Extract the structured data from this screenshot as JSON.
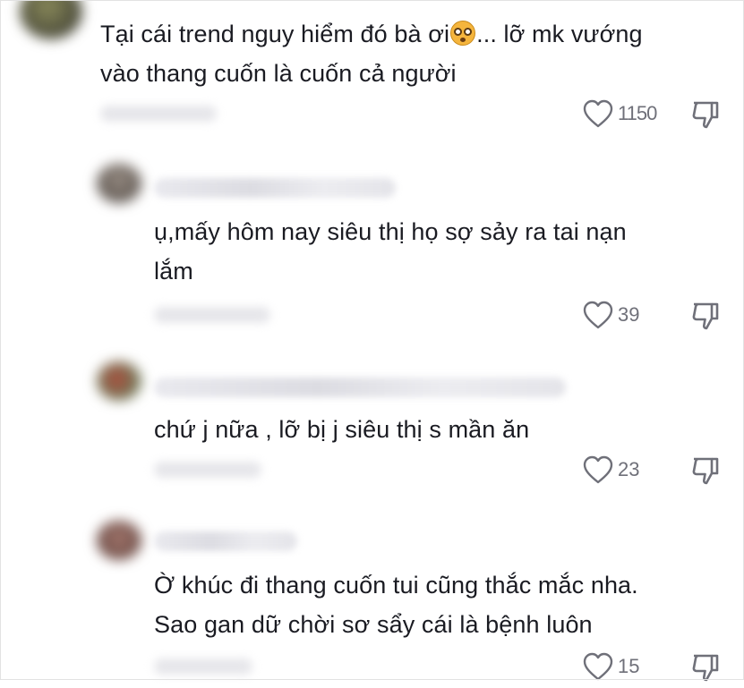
{
  "comments": [
    {
      "text_before_emoji": "Tại cái trend nguy hiểm đó bà ơi",
      "text_after_emoji": "... lỡ mk vướng",
      "text_line2": "vào thang cuốn là cuốn cả người",
      "emoji": "flushed-face",
      "likes": "1150"
    },
    {
      "text_line1": "ụ,mấy hôm nay siêu thị họ sợ sảy ra tai nạn",
      "text_line2": "lắm",
      "likes": "39"
    },
    {
      "text_line1": "chứ j nữa , lỡ bị j siêu thị s mần ăn",
      "likes": "23"
    },
    {
      "text_line1": "Ờ khúc đi thang cuốn tui cũng thắc mắc nha.",
      "text_line2": "Sao gan dữ chời sơ sẩy cái là bệnh luôn",
      "likes": "15"
    }
  ],
  "icons": {
    "like": "heart-outline-icon",
    "dislike": "thumbs-down-outline-icon"
  },
  "colors": {
    "text": "#1a1b22",
    "meta": "#6f7079",
    "background": "#ffffff"
  }
}
